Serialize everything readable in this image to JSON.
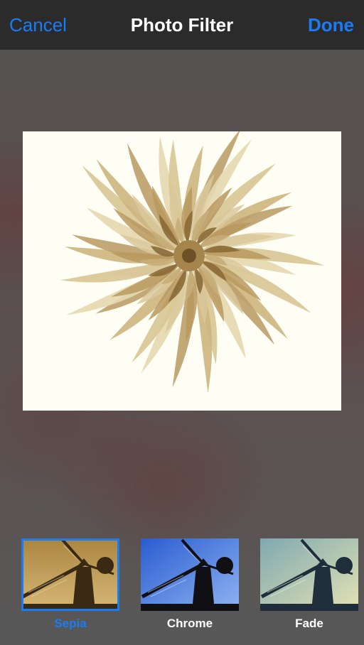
{
  "navbar": {
    "cancel_label": "Cancel",
    "title": "Photo Filter",
    "done_label": "Done"
  },
  "photo": {
    "subject": "dahlia-flower",
    "filter_applied": "Sepia"
  },
  "filters": [
    {
      "label": "Sepia",
      "selected": true,
      "tint": "#b0894a"
    },
    {
      "label": "Chrome",
      "selected": false,
      "tint": "#3f6fd8"
    },
    {
      "label": "Fade",
      "selected": false,
      "tint": "#9bc0b0"
    }
  ],
  "colors": {
    "accent": "#1a7cf5",
    "navbar_bg": "#2b2b2b",
    "title_text": "#ffffff"
  }
}
